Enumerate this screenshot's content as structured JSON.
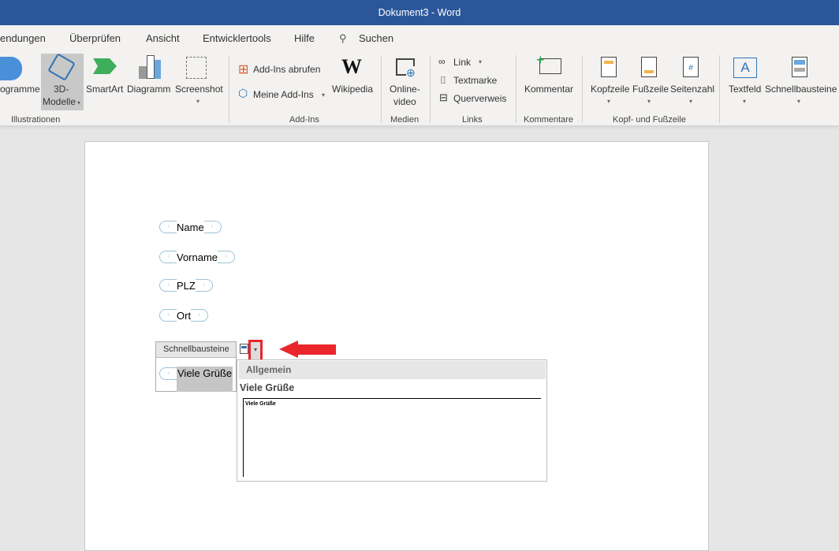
{
  "title": "Dokument3  -  Word",
  "tabs": [
    "endungen",
    "Überprüfen",
    "Ansicht",
    "Entwicklertools",
    "Hilfe"
  ],
  "search": "Suchen",
  "ribbon": {
    "programme": "ogramme",
    "modelle1": "3D-",
    "modelle2": "Modelle",
    "smartart": "SmartArt",
    "diagramm": "Diagramm",
    "screenshot": "Screenshot",
    "illustrationen": "Illustrationen",
    "addins_get": "Add-Ins abrufen",
    "my_addins": "Meine Add-Ins",
    "wikipedia": "Wikipedia",
    "addins": "Add-Ins",
    "online1": "Online-",
    "online2": "video",
    "medien": "Medien",
    "link": "Link",
    "textmarke": "Textmarke",
    "querverweis": "Querverweis",
    "links": "Links",
    "kommentar": "Kommentar",
    "kommentare": "Kommentare",
    "kopfzeile": "Kopfzeile",
    "fusszeile": "Fußzeile",
    "seitenzahl": "Seitenzahl",
    "kopf_fuss": "Kopf- und Fußzeile",
    "textfeld": "Textfeld",
    "schnellbausteine": "Schnellbausteine"
  },
  "doc": {
    "fields": [
      "Name",
      "Vorname",
      "PLZ",
      "Ort"
    ],
    "selected": "Viele Grüße"
  },
  "popup": {
    "title": "Schnellbausteine",
    "category": "Allgemein",
    "entry": "Viele Grüße",
    "preview": "Viele Grüße"
  },
  "colors": {
    "accent": "#2b579a",
    "arrow": "#e8262c"
  }
}
